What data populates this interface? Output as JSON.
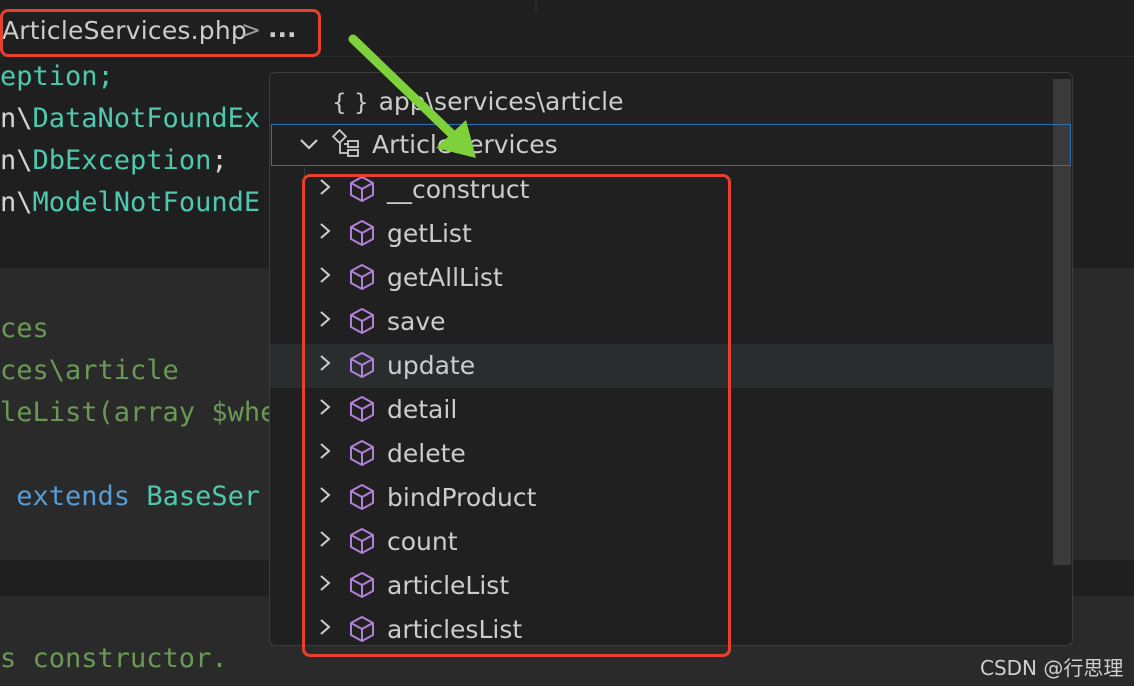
{
  "breadcrumb": {
    "file": "ArticleServices.php",
    "separator": ">",
    "more": "..."
  },
  "code_lines": [
    {
      "text": "eption;"
    },
    {
      "text": "n\\DataNotFoundEx"
    },
    {
      "text": "n\\DbException;"
    },
    {
      "text": "n\\ModelNotFoundE"
    },
    {
      "text": "ces"
    },
    {
      "text": "ces\\article"
    },
    {
      "text": "leList(array $whe"
    },
    {
      "text": " extends BaseSer"
    },
    {
      "text": "s constructor."
    }
  ],
  "outline": {
    "namespace": "app\\services\\article",
    "namespace_icon": "{ }",
    "class_name": "ArticleServices",
    "methods": [
      "__construct",
      "getList",
      "getAllList",
      "save",
      "update",
      "detail",
      "delete",
      "bindProduct",
      "count",
      "articleList",
      "articlesList"
    ],
    "hovered_method": "update"
  },
  "colors": {
    "highlight_box": "#e8402f",
    "arrow": "#7ed13a",
    "method_icon": "#b180d7",
    "focus_border": "#2f6fb5"
  },
  "watermark": "CSDN @行思理"
}
